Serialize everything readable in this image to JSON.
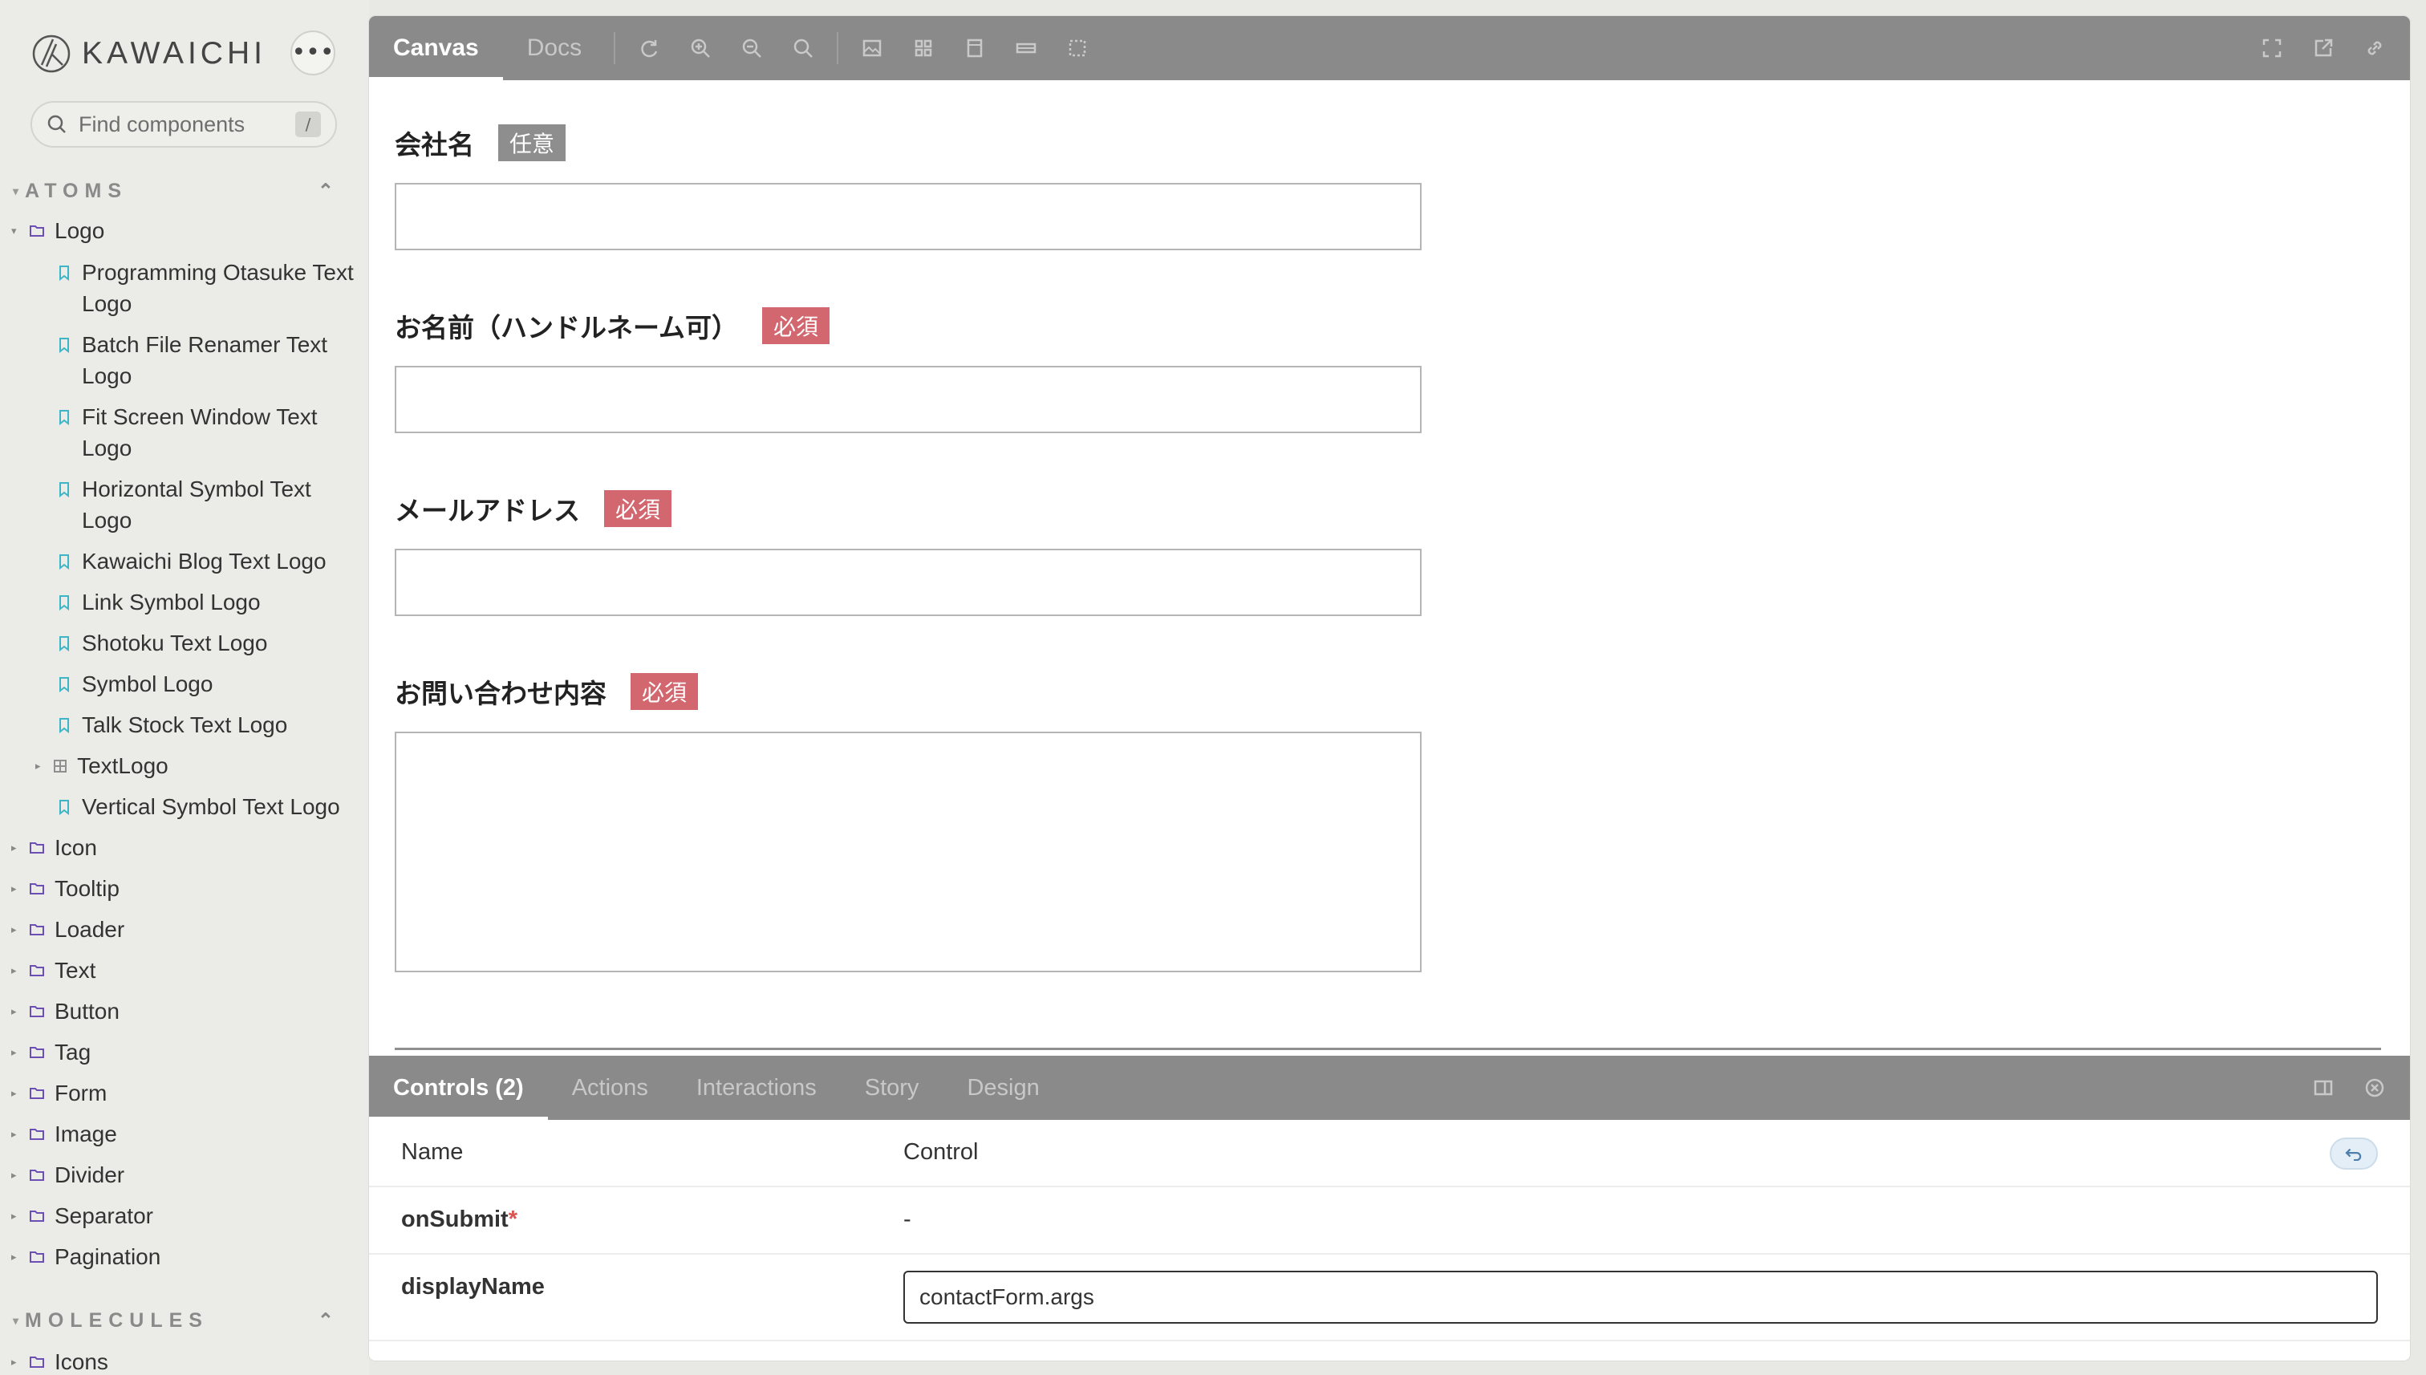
{
  "brand": {
    "name": "KAWAICHI"
  },
  "search": {
    "placeholder": "Find components",
    "shortcut": "/"
  },
  "sidebar": {
    "sections": [
      {
        "label": "ATOMS"
      },
      {
        "label": "MOLECULES"
      }
    ],
    "logo_group": "Logo",
    "stories": [
      {
        "label": "Programming Otasuke Text Logo"
      },
      {
        "label": "Batch File Renamer Text Logo"
      },
      {
        "label": "Fit Screen Window Text Logo"
      },
      {
        "label": "Horizontal Symbol Text Logo"
      },
      {
        "label": "Kawaichi Blog Text Logo"
      },
      {
        "label": "Link Symbol Logo"
      },
      {
        "label": "Shotoku Text Logo"
      },
      {
        "label": "Symbol Logo"
      },
      {
        "label": "Talk Stock Text Logo"
      },
      {
        "label": "TextLogo"
      },
      {
        "label": "Vertical Symbol Text Logo"
      }
    ],
    "groups": [
      {
        "label": "Icon"
      },
      {
        "label": "Tooltip"
      },
      {
        "label": "Loader"
      },
      {
        "label": "Text"
      },
      {
        "label": "Button"
      },
      {
        "label": "Tag"
      },
      {
        "label": "Form"
      },
      {
        "label": "Image"
      },
      {
        "label": "Divider"
      },
      {
        "label": "Separator"
      },
      {
        "label": "Pagination"
      }
    ],
    "molecule_groups": [
      {
        "label": "Icons"
      }
    ]
  },
  "toolbar": {
    "tabs": [
      {
        "label": "Canvas"
      },
      {
        "label": "Docs"
      }
    ],
    "icons": [
      "sync-icon",
      "zoom-in-icon",
      "zoom-out-icon",
      "zoom-reset-icon",
      "background-icon",
      "grid-icon",
      "viewport-icon",
      "measure-icon",
      "outline-icon"
    ],
    "right_icons": [
      "fullscreen-icon",
      "open-new-tab-icon",
      "copy-link-icon"
    ]
  },
  "form": {
    "fields": [
      {
        "label": "会社名",
        "badge": "任意"
      },
      {
        "label": "お名前（ハンドルネーム可）",
        "badge": "必須"
      },
      {
        "label": "メールアドレス",
        "badge": "必須"
      },
      {
        "label": "お問い合わせ内容",
        "badge": "必須"
      }
    ]
  },
  "addons": {
    "tabs": [
      {
        "label": "Controls (2)"
      },
      {
        "label": "Actions"
      },
      {
        "label": "Interactions"
      },
      {
        "label": "Story"
      },
      {
        "label": "Design"
      }
    ],
    "head": {
      "name": "Name",
      "control": "Control"
    },
    "rows": [
      {
        "name": "onSubmit",
        "required_mark": "*",
        "value": "-"
      },
      {
        "name": "displayName",
        "value": "contactForm.args"
      }
    ]
  },
  "colors": {
    "toolbar": "#8a8a8a",
    "required_badge": "#d2676f",
    "optional_badge": "#8e8e8e",
    "story_icon": "#3cb6c7",
    "folder_icon": "#6b4fb5"
  }
}
